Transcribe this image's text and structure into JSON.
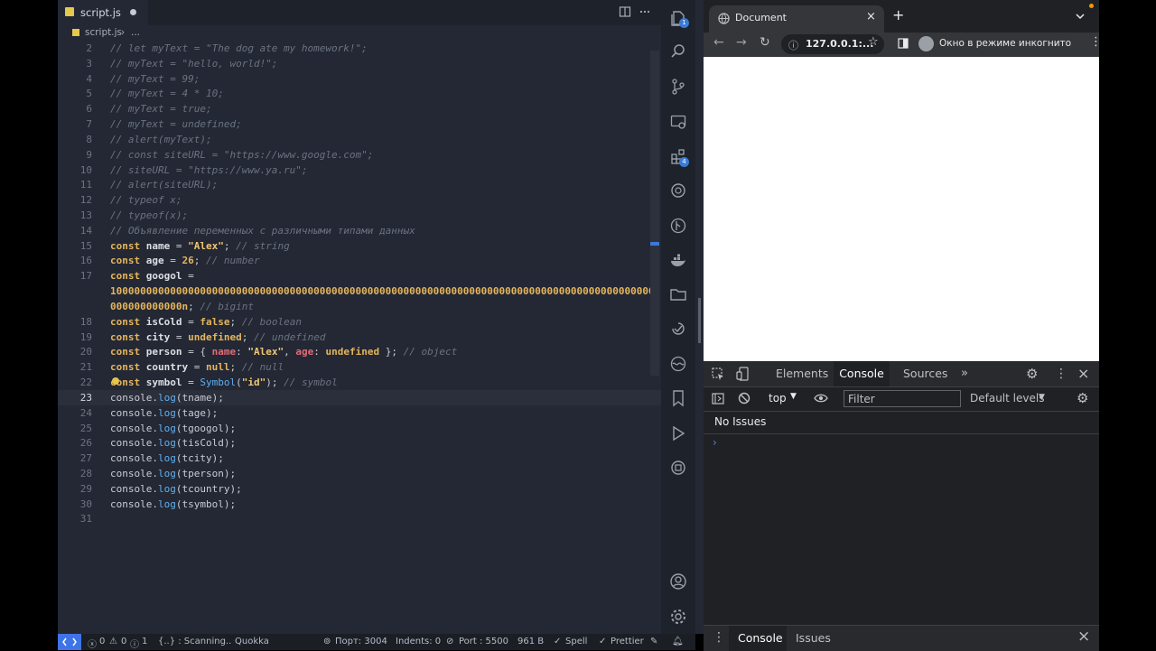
{
  "editor": {
    "tab_label": "script.js",
    "breadcrumb": [
      "script.js",
      "..."
    ],
    "current_line": 23,
    "lines": [
      {
        "n": "2",
        "tokens": [
          [
            "cm",
            "// let myText = \"The dog ate my homework!\";"
          ]
        ]
      },
      {
        "n": "3",
        "tokens": [
          [
            "cm",
            "// myText = \"hello, world!\";"
          ]
        ]
      },
      {
        "n": "4",
        "tokens": [
          [
            "cm",
            "// myText = 99;"
          ]
        ]
      },
      {
        "n": "5",
        "tokens": [
          [
            "cm",
            "// myText = 4 * 10;"
          ]
        ]
      },
      {
        "n": "6",
        "tokens": [
          [
            "cm",
            "// myText = true;"
          ]
        ]
      },
      {
        "n": "7",
        "tokens": [
          [
            "cm",
            "// myText = undefined;"
          ]
        ]
      },
      {
        "n": "8",
        "tokens": [
          [
            "cm",
            "// alert(myText);"
          ]
        ]
      },
      {
        "n": "9",
        "tokens": [
          [
            "cm",
            "// const siteURL = \"https://www.google.com\";"
          ]
        ]
      },
      {
        "n": "10",
        "tokens": [
          [
            "cm",
            "// siteURL = \"https://www.ya.ru\";"
          ]
        ]
      },
      {
        "n": "11",
        "tokens": [
          [
            "cm",
            "// alert(siteURL);"
          ]
        ]
      },
      {
        "n": "12",
        "tokens": [
          [
            "cm",
            "// typeof x;"
          ]
        ]
      },
      {
        "n": "13",
        "tokens": [
          [
            "cm",
            "// typeof(x);"
          ]
        ]
      },
      {
        "n": "14",
        "tokens": [
          [
            "cm",
            "// Объявление переменных с различными типами данных"
          ]
        ]
      },
      {
        "n": "15",
        "tokens": [
          [
            "kw",
            "const "
          ],
          [
            "vr",
            "name"
          ],
          [
            "pl",
            " = "
          ],
          [
            "st",
            "\"Alex\""
          ],
          [
            "pl",
            "; "
          ],
          [
            "cm",
            "// string"
          ]
        ]
      },
      {
        "n": "16",
        "tokens": [
          [
            "kw",
            "const "
          ],
          [
            "vr",
            "age"
          ],
          [
            "pl",
            " = "
          ],
          [
            "nu",
            "26"
          ],
          [
            "pl",
            "; "
          ],
          [
            "cm",
            "// number"
          ]
        ]
      },
      {
        "n": "17",
        "tokens": [
          [
            "kw",
            "const "
          ],
          [
            "vr",
            "googol"
          ],
          [
            "pl",
            " ="
          ]
        ]
      },
      {
        "n": "",
        "tokens": [
          [
            "nu",
            "1000000000000000000000000000000000000000000000000000000000000000000000000000000000000000000"
          ]
        ]
      },
      {
        "n": "",
        "tokens": [
          [
            "nu",
            "000000000000n"
          ],
          [
            "pl",
            "; "
          ],
          [
            "cm",
            "// bigint"
          ]
        ]
      },
      {
        "n": "18",
        "tokens": [
          [
            "kw",
            "const "
          ],
          [
            "vr",
            "isCold"
          ],
          [
            "pl",
            " = "
          ],
          [
            "nu",
            "false"
          ],
          [
            "pl",
            "; "
          ],
          [
            "cm",
            "// boolean"
          ]
        ]
      },
      {
        "n": "19",
        "tokens": [
          [
            "kw",
            "const "
          ],
          [
            "vr",
            "city"
          ],
          [
            "pl",
            " = "
          ],
          [
            "nu",
            "undefined"
          ],
          [
            "pl",
            "; "
          ],
          [
            "cm",
            "// undefined"
          ]
        ]
      },
      {
        "n": "20",
        "tokens": [
          [
            "kw",
            "const "
          ],
          [
            "vr",
            "person"
          ],
          [
            "pl",
            " = { "
          ],
          [
            "ky",
            "name"
          ],
          [
            "pl",
            ": "
          ],
          [
            "st",
            "\"Alex\""
          ],
          [
            "pl",
            ", "
          ],
          [
            "ky",
            "age"
          ],
          [
            "pl",
            ": "
          ],
          [
            "nu",
            "undefined"
          ],
          [
            "pl",
            " }; "
          ],
          [
            "cm",
            "// object"
          ]
        ]
      },
      {
        "n": "21",
        "tokens": [
          [
            "kw",
            "const "
          ],
          [
            "vr",
            "country"
          ],
          [
            "pl",
            " = "
          ],
          [
            "nu",
            "null"
          ],
          [
            "pl",
            "; "
          ],
          [
            "cm",
            "// null"
          ]
        ]
      },
      {
        "n": "22",
        "tokens": [
          [
            "kw",
            "const "
          ],
          [
            "vr",
            "symbol"
          ],
          [
            "pl",
            " = "
          ],
          [
            "fn",
            "Symbol"
          ],
          [
            "pl",
            "("
          ],
          [
            "st",
            "\"id\""
          ],
          [
            "pl",
            "); "
          ],
          [
            "cm",
            "// symbol"
          ]
        ]
      },
      {
        "n": "23",
        "tokens": [
          [
            "pl",
            "console."
          ],
          [
            "fn",
            "log"
          ],
          [
            "pl",
            "(tname);"
          ]
        ]
      },
      {
        "n": "24",
        "tokens": [
          [
            "pl",
            "console."
          ],
          [
            "fn",
            "log"
          ],
          [
            "pl",
            "(tage);"
          ]
        ]
      },
      {
        "n": "25",
        "tokens": [
          [
            "pl",
            "console."
          ],
          [
            "fn",
            "log"
          ],
          [
            "pl",
            "(tgoogol);"
          ]
        ]
      },
      {
        "n": "26",
        "tokens": [
          [
            "pl",
            "console."
          ],
          [
            "fn",
            "log"
          ],
          [
            "pl",
            "(tisCold);"
          ]
        ]
      },
      {
        "n": "27",
        "tokens": [
          [
            "pl",
            "console."
          ],
          [
            "fn",
            "log"
          ],
          [
            "pl",
            "(tcity);"
          ]
        ]
      },
      {
        "n": "28",
        "tokens": [
          [
            "pl",
            "console."
          ],
          [
            "fn",
            "log"
          ],
          [
            "pl",
            "(tperson);"
          ]
        ]
      },
      {
        "n": "29",
        "tokens": [
          [
            "pl",
            "console."
          ],
          [
            "fn",
            "log"
          ],
          [
            "pl",
            "(tcountry);"
          ]
        ]
      },
      {
        "n": "30",
        "tokens": [
          [
            "pl",
            "console."
          ],
          [
            "fn",
            "log"
          ],
          [
            "pl",
            "(tsymbol);"
          ]
        ]
      },
      {
        "n": "31",
        "tokens": []
      }
    ]
  },
  "activity_bar": {
    "source_control_badge": "1",
    "extensions_badge": "4"
  },
  "status_bar": {
    "errors": "0",
    "warnings": "0",
    "info": "1",
    "scanning": "{..} : Scanning..",
    "quokka": "Quokka",
    "port_label": "Порт: 3004",
    "indents": "Indents: 0",
    "live_port": "Port : 5500",
    "size": "961 B",
    "spell": "Spell",
    "prettier": "Prettier"
  },
  "browser": {
    "tab_title": "Document",
    "url": "127.0.0.1:...",
    "incognito_label": "Окно в режиме инкогнито",
    "devtools": {
      "tabs": [
        "Elements",
        "Console",
        "Sources"
      ],
      "active_tab": "Console",
      "context": "top",
      "filter_placeholder": "Filter",
      "levels": "Default levels",
      "issues": "No Issues",
      "prompt": "›",
      "drawer_tabs": [
        "Console",
        "Issues"
      ]
    }
  },
  "colors": {
    "editor_bg": "#232834",
    "keyword": "#e5b55c",
    "string": "#f0c674",
    "comment": "#6b7280",
    "function": "#61afef",
    "accent": "#3f74e8"
  }
}
